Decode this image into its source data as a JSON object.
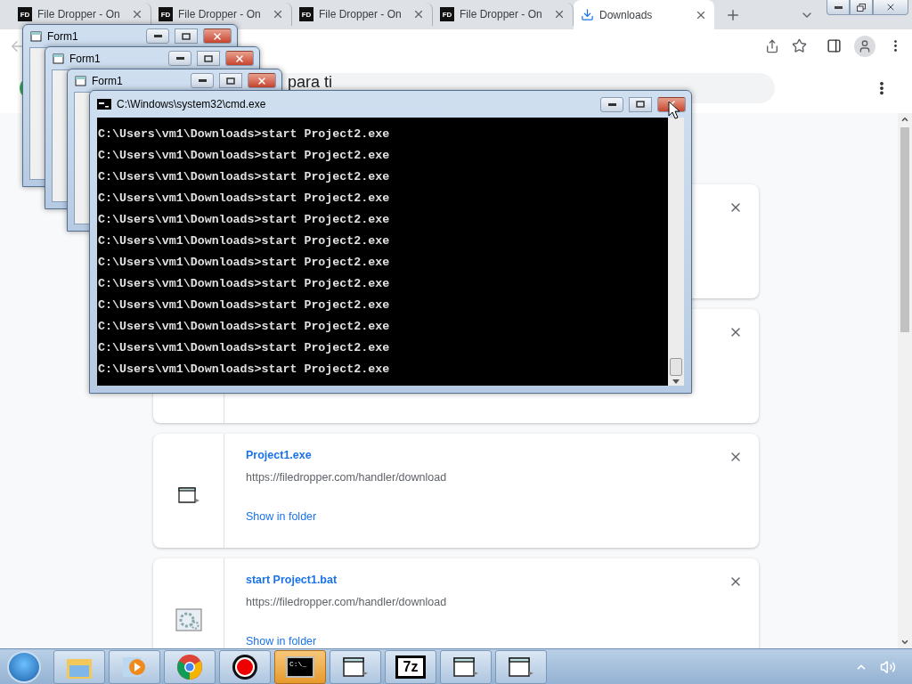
{
  "browser": {
    "tabs": [
      {
        "favicon": "FD",
        "label": "File Dropper - On",
        "selected": false
      },
      {
        "favicon": "FD",
        "label": "File Dropper - On",
        "selected": false
      },
      {
        "favicon": "FD",
        "label": "File Dropper - On",
        "selected": false
      },
      {
        "favicon": "FD",
        "label": "File Dropper - On",
        "selected": false
      },
      {
        "label": "Downloads",
        "selected": true
      }
    ],
    "search": {
      "value": "para ti"
    },
    "downloads": [
      {
        "kind": "covered"
      },
      {
        "kind": "covered"
      },
      {
        "kind": "exe",
        "name": "Project1.exe",
        "url": "https://filedropper.com/handler/download",
        "action": "Show in folder"
      },
      {
        "kind": "bat",
        "name": "start Project1.bat",
        "url": "https://filedropper.com/handler/download",
        "action": "Show in folder"
      }
    ]
  },
  "forms": [
    {
      "title": "Form1"
    },
    {
      "title": "Form1"
    },
    {
      "title": "Form1"
    }
  ],
  "console": {
    "title": "C:\\Windows\\system32\\cmd.exe",
    "lines": [
      "C:\\Users\\vm1\\Downloads>start Project2.exe",
      "C:\\Users\\vm1\\Downloads>start Project2.exe",
      "C:\\Users\\vm1\\Downloads>start Project2.exe",
      "C:\\Users\\vm1\\Downloads>start Project2.exe",
      "C:\\Users\\vm1\\Downloads>start Project2.exe",
      "C:\\Users\\vm1\\Downloads>start Project2.exe",
      "C:\\Users\\vm1\\Downloads>start Project2.exe",
      "C:\\Users\\vm1\\Downloads>start Project2.exe",
      "C:\\Users\\vm1\\Downloads>start Project2.exe",
      "C:\\Users\\vm1\\Downloads>start Project2.exe",
      "C:\\Users\\vm1\\Downloads>start Project2.exe",
      "C:\\Users\\vm1\\Downloads>start Project2.exe"
    ]
  },
  "taskbar": {
    "items": [
      {
        "kind": "explorer",
        "selected": false
      },
      {
        "kind": "media",
        "selected": false
      },
      {
        "kind": "chrome",
        "selected": false
      },
      {
        "kind": "record",
        "selected": false
      },
      {
        "kind": "console",
        "label": "C:\\_",
        "selected": true
      },
      {
        "kind": "window",
        "selected": false
      },
      {
        "kind": "archive",
        "label": "7z",
        "selected": false
      },
      {
        "kind": "window",
        "selected": false
      },
      {
        "kind": "window",
        "selected": false
      }
    ]
  }
}
